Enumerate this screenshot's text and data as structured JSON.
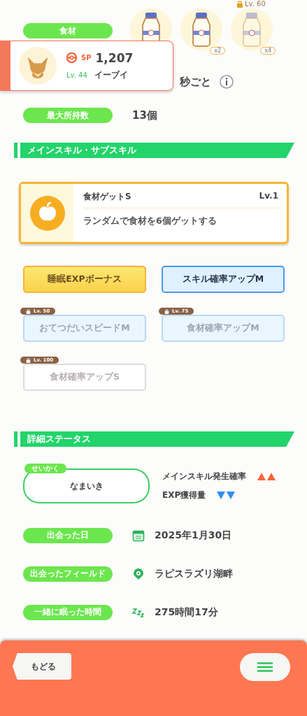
{
  "ingredients": {
    "label": "食材",
    "items": [
      {
        "locked": false
      },
      {
        "count": "x2",
        "locked": false
      },
      {
        "count": "x4",
        "locked": true,
        "lock_level": "Lv. 60"
      }
    ]
  },
  "help_interval": {
    "value": "秒ごと"
  },
  "max_carry": {
    "label": "最大所持数",
    "value": "13個"
  },
  "popup": {
    "sp_label": "SP",
    "sp": "1,207",
    "level": "Lv. 44",
    "name": "イーブイ"
  },
  "skills_section": {
    "title": "メインスキル・サブスキル"
  },
  "main_skill": {
    "name": "食材ゲットS",
    "level": "Lv.1",
    "description": "ランダムで食材を6個ゲットする"
  },
  "sub_skills": [
    {
      "label": "睡眠EXPボーナス",
      "kind": "gold",
      "locked": false
    },
    {
      "label": "スキル確率アップM",
      "kind": "blue",
      "locked": false
    },
    {
      "label": "おてつだいスピードM",
      "kind": "blue",
      "locked": true,
      "lock_level": "Lv. 50"
    },
    {
      "label": "食材確率アップM",
      "kind": "blue",
      "locked": true,
      "lock_level": "Lv. 75"
    },
    {
      "label": "食材確率アップS",
      "kind": "white",
      "locked": true,
      "lock_level": "Lv. 100"
    }
  ],
  "details_section": {
    "title": "詳細ステータス"
  },
  "nature": {
    "tag": "せいかく",
    "name": "なまいき",
    "effects": [
      {
        "label": "メインスキル発生確率",
        "kind": "up"
      },
      {
        "label": "EXP獲得量",
        "kind": "down"
      }
    ]
  },
  "details": [
    {
      "label": "出会った日",
      "kind": "calendar",
      "value": "2025年1月30日"
    },
    {
      "label": "出会ったフィールド",
      "kind": "field",
      "value": "ラピスラズリ湖畔"
    },
    {
      "label": "一緒に眠った時間",
      "kind": "sleep",
      "value": "275時間17分"
    }
  ],
  "footer": {
    "back": "もどる"
  }
}
